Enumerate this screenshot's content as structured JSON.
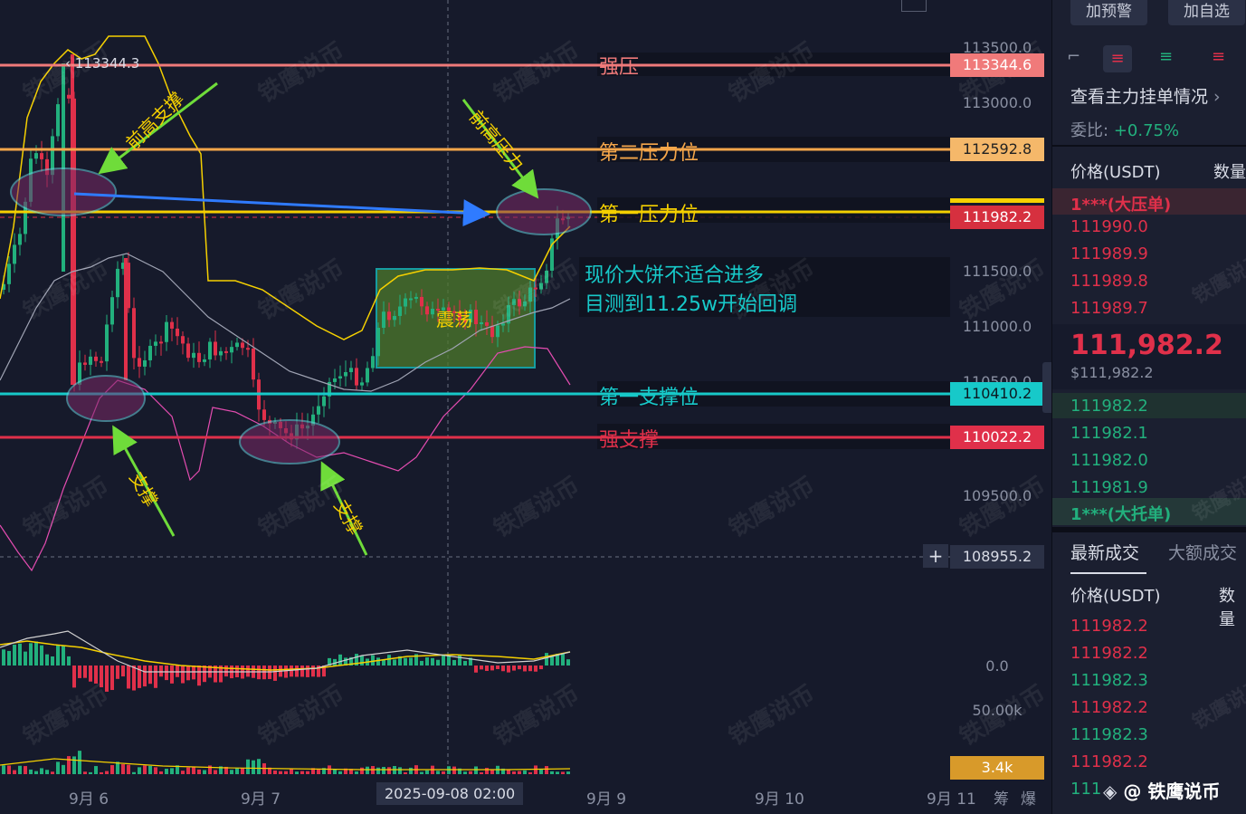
{
  "chart": {
    "y_axis_ticks": [
      "113500.0",
      "113000.0",
      "111500.0",
      "111000.0",
      "110500.0",
      "109500.0"
    ],
    "price_tags": {
      "strong_resist": "113344.6",
      "second_resist": "112592.8",
      "current": "111982.2",
      "first_support": "110410.2",
      "strong_support": "110022.2",
      "crosshair": "108955.2"
    },
    "high_marker": "113344.3",
    "levels": {
      "strong_resist": "强压",
      "second_resist": "第二压力位",
      "first_resist": "第一压力位",
      "first_support": "第一支撑位",
      "strong_support": "强支撑"
    },
    "annotations": {
      "prev_high_support": "前高支撑",
      "prev_high_resist": "前高压力",
      "range": "震荡",
      "support1": "支撑",
      "support2": "支撑",
      "comment_line1": "现价大饼不适合进多",
      "comment_line2": "目测到11.25w开始回调"
    },
    "indicator_labels": {
      "macd_zero": "0.0",
      "vol_scale": "50.00k",
      "vol_tag": "3.4k"
    },
    "x_axis": [
      "9月 6",
      "9月 7",
      "2025-09-08 02:00",
      "9月 9",
      "9月 10",
      "9月 11"
    ],
    "x_axis_extra": [
      "筹",
      "爆"
    ],
    "watermark": "铁鹰说币",
    "colors": {
      "bg": "#161a2b",
      "up": "#22b07d",
      "down": "#e0304a",
      "yellow": "#f5d000",
      "cyan": "#17c9c9"
    }
  },
  "panel": {
    "btn_alert": "加预警",
    "btn_watch": "加自选",
    "orders_link": "查看主力挂单情况",
    "ratio_label": "委比:",
    "ratio_value": "+0.75%",
    "col_price": "价格(USDT)",
    "col_qty": "数量",
    "big_ask": "1***(大压单)",
    "asks": [
      "111990.0",
      "111989.9",
      "111989.8",
      "111989.7"
    ],
    "last_price": "111,982.2",
    "last_price_usd": "$111,982.2",
    "bids": [
      "111982.2",
      "111982.1",
      "111982.0",
      "111981.9"
    ],
    "big_bid": "1***(大托单)",
    "tab_latest": "最新成交",
    "tab_large": "大额成交",
    "col_price2": "价格(USDT)",
    "col_qty2": "数量",
    "trades": [
      {
        "p": "111982.2",
        "side": "down"
      },
      {
        "p": "111982.2",
        "side": "down"
      },
      {
        "p": "111982.3",
        "side": "up"
      },
      {
        "p": "111982.2",
        "side": "down"
      },
      {
        "p": "111982.3",
        "side": "up"
      },
      {
        "p": "111982.2",
        "side": "down"
      },
      {
        "p": "111",
        "side": "up"
      }
    ],
    "footer_brand": "@ 铁鹰说币"
  }
}
